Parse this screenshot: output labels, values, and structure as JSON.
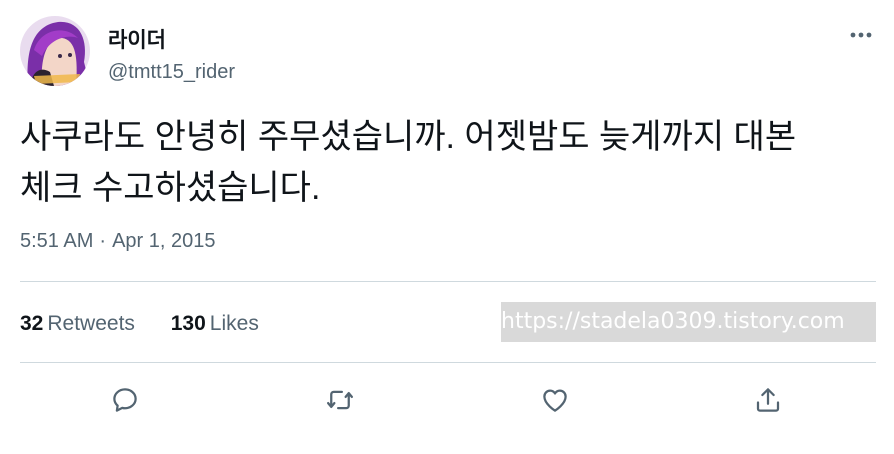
{
  "author": {
    "display_name": "라이더",
    "handle": "@tmtt15_rider"
  },
  "tweet": {
    "text_line1": "사쿠라도 안녕히 주무셨습니까. 어젯밤도 늦게까지 대본",
    "text_line2": "체크 수고하셨습니다.",
    "time": "5:51 AM",
    "separator": "·",
    "date": "Apr 1, 2015"
  },
  "stats": {
    "retweets_count": "32",
    "retweets_label": "Retweets",
    "likes_count": "130",
    "likes_label": "Likes"
  },
  "watermark": {
    "text": "https://stadela0309.tistory.com"
  },
  "icons": {
    "more": "more-horizontal-icon",
    "reply": "reply-icon",
    "retweet": "retweet-icon",
    "like": "heart-icon",
    "share": "share-icon"
  },
  "colors": {
    "primary_text": "#0f1419",
    "secondary_text": "#536471",
    "divider": "#cfd9de",
    "watermark_bg": "#d9d9d9"
  }
}
